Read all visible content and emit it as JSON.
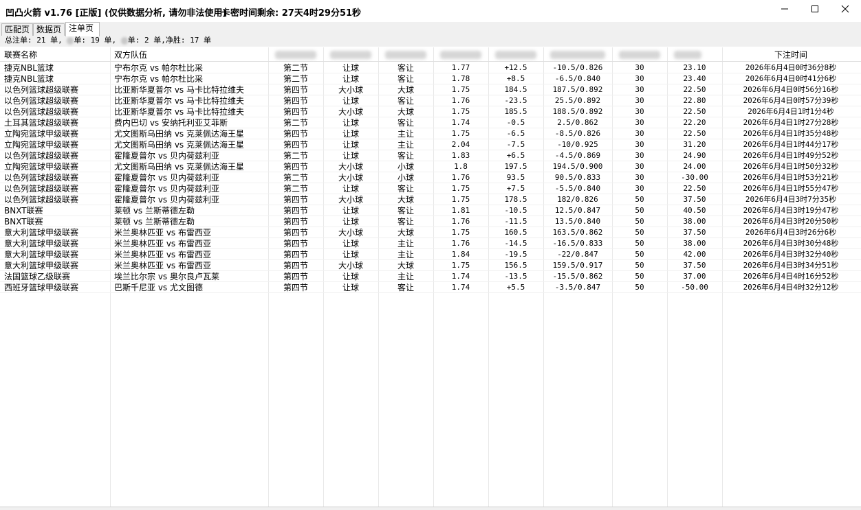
{
  "window": {
    "title": "凹凸火箭 v1.76 [正版] (仅供数据分析, 请勿非法使用)",
    "timer": "卡密时间剩余: 27天4时29分51秒",
    "controls": {
      "minimize": "—",
      "maximize": "☐",
      "close": "✕"
    }
  },
  "tabs": [
    {
      "label": "匹配页"
    },
    {
      "label": "数据页"
    },
    {
      "label": "注单页"
    }
  ],
  "summary": {
    "part1": "总注单: 21 单,",
    "part2": "单: 19 单,",
    "part3": "单: 2 单,净胜: 17 单"
  },
  "table": {
    "headers": {
      "league": "联赛名称",
      "teams": "双方队伍",
      "time": "下注时间"
    },
    "rows": [
      [
        "捷克NBL篮球",
        "宁布尔克 vs 帕尔杜比采",
        "第二节",
        "让球",
        "客让",
        "1.77",
        "+12.5",
        "-10.5/0.826",
        "30",
        "23.10",
        "2026年6月4日0时36分8秒"
      ],
      [
        "捷克NBL篮球",
        "宁布尔克 vs 帕尔杜比采",
        "第二节",
        "让球",
        "客让",
        "1.78",
        "+8.5",
        "-6.5/0.840",
        "30",
        "23.40",
        "2026年6月4日0时41分6秒"
      ],
      [
        "以色列篮球超级联赛",
        "比亚斯华夏普尔 vs 马卡比特拉维夫",
        "第四节",
        "大小球",
        "大球",
        "1.75",
        "184.5",
        "187.5/0.892",
        "30",
        "22.50",
        "2026年6月4日0时56分16秒"
      ],
      [
        "以色列篮球超级联赛",
        "比亚斯华夏普尔 vs 马卡比特拉维夫",
        "第四节",
        "让球",
        "客让",
        "1.76",
        "-23.5",
        "25.5/0.892",
        "30",
        "22.80",
        "2026年6月4日0时57分39秒"
      ],
      [
        "以色列篮球超级联赛",
        "比亚斯华夏普尔 vs 马卡比特拉维夫",
        "第四节",
        "大小球",
        "大球",
        "1.75",
        "185.5",
        "188.5/0.892",
        "30",
        "22.50",
        "2026年6月4日1时1分4秒"
      ],
      [
        "土耳其篮球超级联赛",
        "费内巴切 vs 安纳托利亚艾菲斯",
        "第二节",
        "让球",
        "客让",
        "1.74",
        "-0.5",
        "2.5/0.862",
        "30",
        "22.20",
        "2026年6月4日1时27分28秒"
      ],
      [
        "立陶宛篮球甲级联赛",
        "尤文图斯乌田纳 vs 克莱佩达海王星",
        "第四节",
        "让球",
        "主让",
        "1.75",
        "-6.5",
        "-8.5/0.826",
        "30",
        "22.50",
        "2026年6月4日1时35分48秒"
      ],
      [
        "立陶宛篮球甲级联赛",
        "尤文图斯乌田纳 vs 克莱佩达海王星",
        "第四节",
        "让球",
        "主让",
        "2.04",
        "-7.5",
        "-10/0.925",
        "30",
        "31.20",
        "2026年6月4日1时44分17秒"
      ],
      [
        "以色列篮球超级联赛",
        "霍隆夏普尔 vs 贝内荷兹利亚",
        "第二节",
        "让球",
        "客让",
        "1.83",
        "+6.5",
        "-4.5/0.869",
        "30",
        "24.90",
        "2026年6月4日1时49分52秒"
      ],
      [
        "立陶宛篮球甲级联赛",
        "尤文图斯乌田纳 vs 克莱佩达海王星",
        "第四节",
        "大小球",
        "小球",
        "1.8",
        "197.5",
        "194.5/0.900",
        "30",
        "24.00",
        "2026年6月4日1时50分32秒"
      ],
      [
        "以色列篮球超级联赛",
        "霍隆夏普尔 vs 贝内荷兹利亚",
        "第二节",
        "大小球",
        "小球",
        "1.76",
        "93.5",
        "90.5/0.833",
        "30",
        "-30.00",
        "2026年6月4日1时53分21秒"
      ],
      [
        "以色列篮球超级联赛",
        "霍隆夏普尔 vs 贝内荷兹利亚",
        "第二节",
        "让球",
        "客让",
        "1.75",
        "+7.5",
        "-5.5/0.840",
        "30",
        "22.50",
        "2026年6月4日1时55分47秒"
      ],
      [
        "以色列篮球超级联赛",
        "霍隆夏普尔 vs 贝内荷兹利亚",
        "第四节",
        "大小球",
        "大球",
        "1.75",
        "178.5",
        "182/0.826",
        "50",
        "37.50",
        "2026年6月4日3时7分35秒"
      ],
      [
        "BNXT联赛",
        "莱顿 vs 兰斯蒂德左勒",
        "第四节",
        "让球",
        "客让",
        "1.81",
        "-10.5",
        "12.5/0.847",
        "50",
        "40.50",
        "2026年6月4日3时19分47秒"
      ],
      [
        "BNXT联赛",
        "莱顿 vs 兰斯蒂德左勒",
        "第四节",
        "让球",
        "客让",
        "1.76",
        "-11.5",
        "13.5/0.840",
        "50",
        "38.00",
        "2026年6月4日3时20分50秒"
      ],
      [
        "意大利篮球甲级联赛",
        "米兰奥林匹亚 vs 布雷西亚",
        "第四节",
        "大小球",
        "大球",
        "1.75",
        "160.5",
        "163.5/0.862",
        "50",
        "37.50",
        "2026年6月4日3时26分6秒"
      ],
      [
        "意大利篮球甲级联赛",
        "米兰奥林匹亚 vs 布雷西亚",
        "第四节",
        "让球",
        "主让",
        "1.76",
        "-14.5",
        "-16.5/0.833",
        "50",
        "38.00",
        "2026年6月4日3时30分48秒"
      ],
      [
        "意大利篮球甲级联赛",
        "米兰奥林匹亚 vs 布雷西亚",
        "第四节",
        "让球",
        "主让",
        "1.84",
        "-19.5",
        "-22/0.847",
        "50",
        "42.00",
        "2026年6月4日3时32分40秒"
      ],
      [
        "意大利篮球甲级联赛",
        "米兰奥林匹亚 vs 布雷西亚",
        "第四节",
        "大小球",
        "大球",
        "1.75",
        "156.5",
        "159.5/0.917",
        "50",
        "37.50",
        "2026年6月4日3时34分51秒"
      ],
      [
        "法国篮球乙级联赛",
        "埃兰比尔宗 vs 奥尔良卢瓦莱",
        "第四节",
        "让球",
        "主让",
        "1.74",
        "-13.5",
        "-15.5/0.862",
        "50",
        "37.00",
        "2026年6月4日4时16分52秒"
      ],
      [
        "西班牙篮球甲级联赛",
        "巴斯千尼亚 vs 尤文图德",
        "第四节",
        "让球",
        "客让",
        "1.74",
        "+5.5",
        "-3.5/0.847",
        "50",
        "-50.00",
        "2026年6月4日4时32分12秒"
      ]
    ]
  }
}
